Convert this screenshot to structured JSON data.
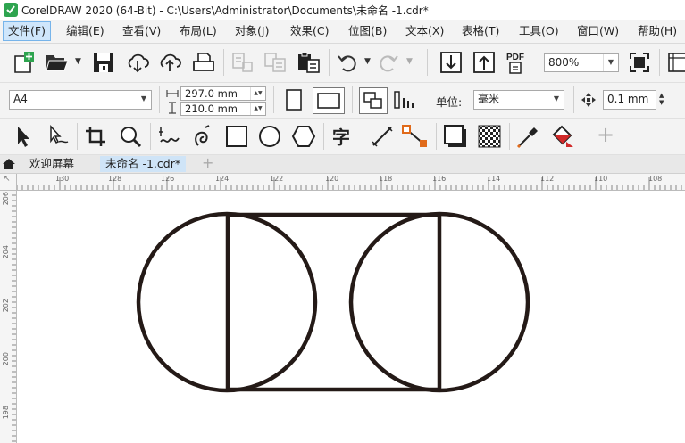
{
  "titlebar": {
    "title": "CorelDRAW 2020 (64-Bit) - C:\\Users\\Administrator\\Documents\\未命名 -1.cdr*",
    "logo_color": "#2ea44f"
  },
  "menu": {
    "items": [
      {
        "label": "文件(F)",
        "active": true
      },
      {
        "label": "编辑(E)"
      },
      {
        "label": "查看(V)"
      },
      {
        "label": "布局(L)"
      },
      {
        "label": "对象(J)"
      },
      {
        "label": "效果(C)"
      },
      {
        "label": "位图(B)"
      },
      {
        "label": "文本(X)"
      },
      {
        "label": "表格(T)"
      },
      {
        "label": "工具(O)"
      },
      {
        "label": "窗口(W)"
      },
      {
        "label": "帮助(H)"
      }
    ]
  },
  "toolbar1": {
    "zoom_value": "800%"
  },
  "toolbar2": {
    "page_size": "A4",
    "width_value": "297.0 mm",
    "height_value": "210.0 mm",
    "units_label": "单位:",
    "units_value": "毫米",
    "nudge_value": "0.1 mm"
  },
  "tabs": {
    "welcome": "欢迎屏幕",
    "document": "未命名 -1.cdr*",
    "add": "+"
  },
  "ruler": {
    "h_ticks": [
      "130",
      "128",
      "126",
      "124",
      "122",
      "120",
      "118",
      "116",
      "114",
      "112",
      "110",
      "108"
    ],
    "v_ticks": [
      "206",
      "204",
      "202",
      "200",
      "198"
    ]
  },
  "drawing": {
    "stroke_color": "#241a17"
  }
}
